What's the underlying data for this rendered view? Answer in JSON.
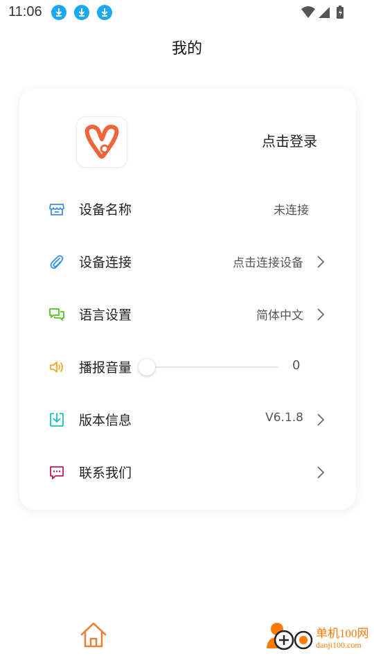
{
  "status_bar": {
    "time": "11:06",
    "download_icons": [
      "download-icon",
      "download-icon",
      "download-icon"
    ],
    "system_icons": [
      "wifi-icon",
      "signal-icon",
      "battery-icon"
    ]
  },
  "page_title": "我的",
  "card": {
    "login_text": "点击登录",
    "rows": [
      {
        "label": "设备名称",
        "value": "未连接",
        "icon": "store-icon",
        "color": "#3a8ee6",
        "chevron": false
      },
      {
        "label": "设备连接",
        "value": "点击连接设备",
        "icon": "paperclip-icon",
        "color": "#3a8ee6",
        "chevron": true
      },
      {
        "label": "语言设置",
        "value": "简体中文",
        "icon": "chat-bubbles-icon",
        "color": "#52c41a",
        "chevron": true
      },
      {
        "label": "播报音量",
        "value": "0",
        "icon": "speaker-icon",
        "color": "#f5a623",
        "chevron": false
      },
      {
        "label": "版本信息",
        "value": "V6.1.8",
        "icon": "download-box-icon",
        "color": "#13c2c2",
        "chevron": true
      },
      {
        "label": "联系我们",
        "value": "",
        "icon": "message-icon",
        "color": "#c2185b",
        "chevron": true
      }
    ],
    "volume_level": 0
  },
  "bottom_nav": {
    "home_icon": "home-icon",
    "profile_icon": "profile-icon"
  },
  "watermark": {
    "line1": "单机100网",
    "line2": "danji100.com"
  },
  "colors": {
    "accent_orange": "#f0643c",
    "download_blue": "#1aa8f0",
    "home_orange": "#e8813c"
  }
}
